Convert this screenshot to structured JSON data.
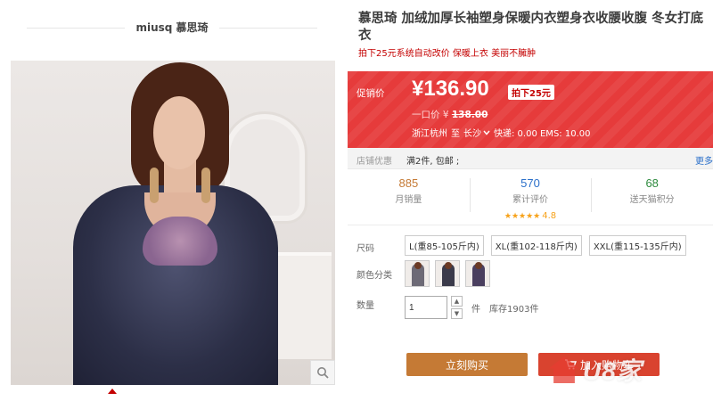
{
  "shop": {
    "name": "miusq 慕思琦"
  },
  "product": {
    "title": "慕思琦 加绒加厚长袖塑身保暖内衣塑身衣收腰收腹 冬女打底衣",
    "subtitle": "拍下25元系统自动改价 保暖上衣 美丽不臃肿"
  },
  "price": {
    "label": "促销价",
    "current": "¥136.90",
    "badge": "拍下25元",
    "original_label": "一口价",
    "original_currency": "¥",
    "original": "138.00",
    "ship_from": "浙江杭州",
    "ship_to_prefix": "至",
    "ship_to": "长沙",
    "shipping": "快递: 0.00 EMS: 10.00"
  },
  "promo": {
    "label": "店铺优惠",
    "text": "满2件, 包邮 ;",
    "more": "更多"
  },
  "stats": [
    {
      "value": "885",
      "label": "月销量",
      "color": "#c57a35"
    },
    {
      "value": "570",
      "label": "累计评价",
      "color": "#2a6fc9",
      "stars": "★★★★★",
      "rating": "4.8"
    },
    {
      "value": "68",
      "label": "送天猫积分",
      "color": "#2e8b3e"
    }
  ],
  "options": {
    "size_label": "尺码",
    "sizes": [
      "L(重85-105斤内)",
      "XL(重102-118斤内)",
      "XXL(重115-135斤内)"
    ],
    "color_label": "颜色分类",
    "colors": [
      "#6d6a76",
      "#3a3a4a",
      "#4a3f5f"
    ],
    "qty_label": "数量",
    "qty_value": "1",
    "qty_unit": "件",
    "stock": "库存1903件"
  },
  "actions": {
    "buy_now": "立刻购买",
    "add_cart": "加入购物车"
  },
  "watermark": {
    "text": "U8家"
  },
  "theme": {
    "accent": "#c40000",
    "price_bg": "#e63b3b",
    "buy_color": "#c57a35",
    "cart_color": "#d9432f"
  }
}
